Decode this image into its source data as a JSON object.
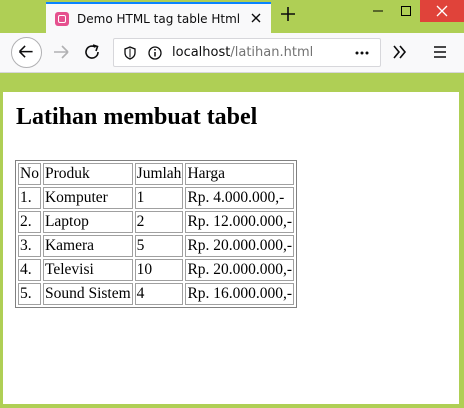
{
  "browser": {
    "tab_title": "Demo HTML tag table Html",
    "url_host": "localhost",
    "url_path": "/latihan.html",
    "accent_color": "#0a84ff",
    "frame_color": "#afcf55",
    "icons": [
      "back-icon",
      "forward-icon",
      "reload-icon",
      "shield-icon",
      "info-icon",
      "more-icon",
      "overflow-icon",
      "menu-icon",
      "close-icon",
      "plus-icon"
    ]
  },
  "page": {
    "heading": "Latihan membuat tabel",
    "table": {
      "headers": [
        "No",
        "Produk",
        "Jumlah",
        "Harga"
      ],
      "rows": [
        [
          "1.",
          "Komputer",
          "1",
          "Rp. 4.000.000,-"
        ],
        [
          "2.",
          "Laptop",
          "2",
          "Rp. 12.000.000,-"
        ],
        [
          "3.",
          "Kamera",
          "5",
          "Rp. 20.000.000,-"
        ],
        [
          "4.",
          "Televisi",
          "10",
          "Rp. 20.000.000,-"
        ],
        [
          "5.",
          "Sound Sistem",
          "4",
          "Rp. 16.000.000,-"
        ]
      ]
    }
  }
}
